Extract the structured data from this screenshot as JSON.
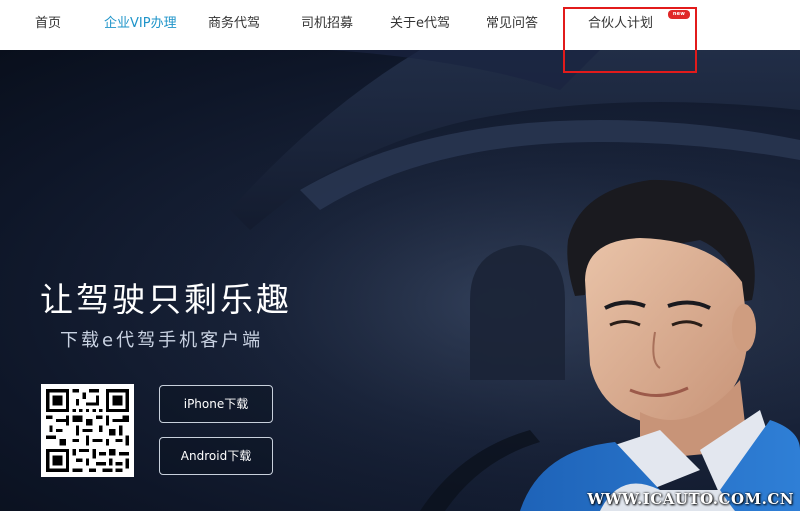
{
  "nav": {
    "items": [
      {
        "label": "首页",
        "active": false
      },
      {
        "label": "企业VIP办理",
        "active": true
      },
      {
        "label": "商务代驾",
        "active": false
      },
      {
        "label": "司机招募",
        "active": false
      },
      {
        "label": "关于e代驾",
        "active": false
      },
      {
        "label": "常见问答",
        "active": false
      },
      {
        "label": "合伙人计划",
        "active": false,
        "badge": "new"
      }
    ],
    "active_color": "#1f94c9",
    "highlight_color": "#e21b1b"
  },
  "hero": {
    "headline": "让驾驶只剩乐趣",
    "subline": "下载e代驾手机客户端",
    "qr_code": "qr-code-icon",
    "buttons": {
      "iphone": "iPhone下载",
      "android": "Android下载"
    }
  },
  "watermark": "WWW.ICAUTO.COM.CN"
}
